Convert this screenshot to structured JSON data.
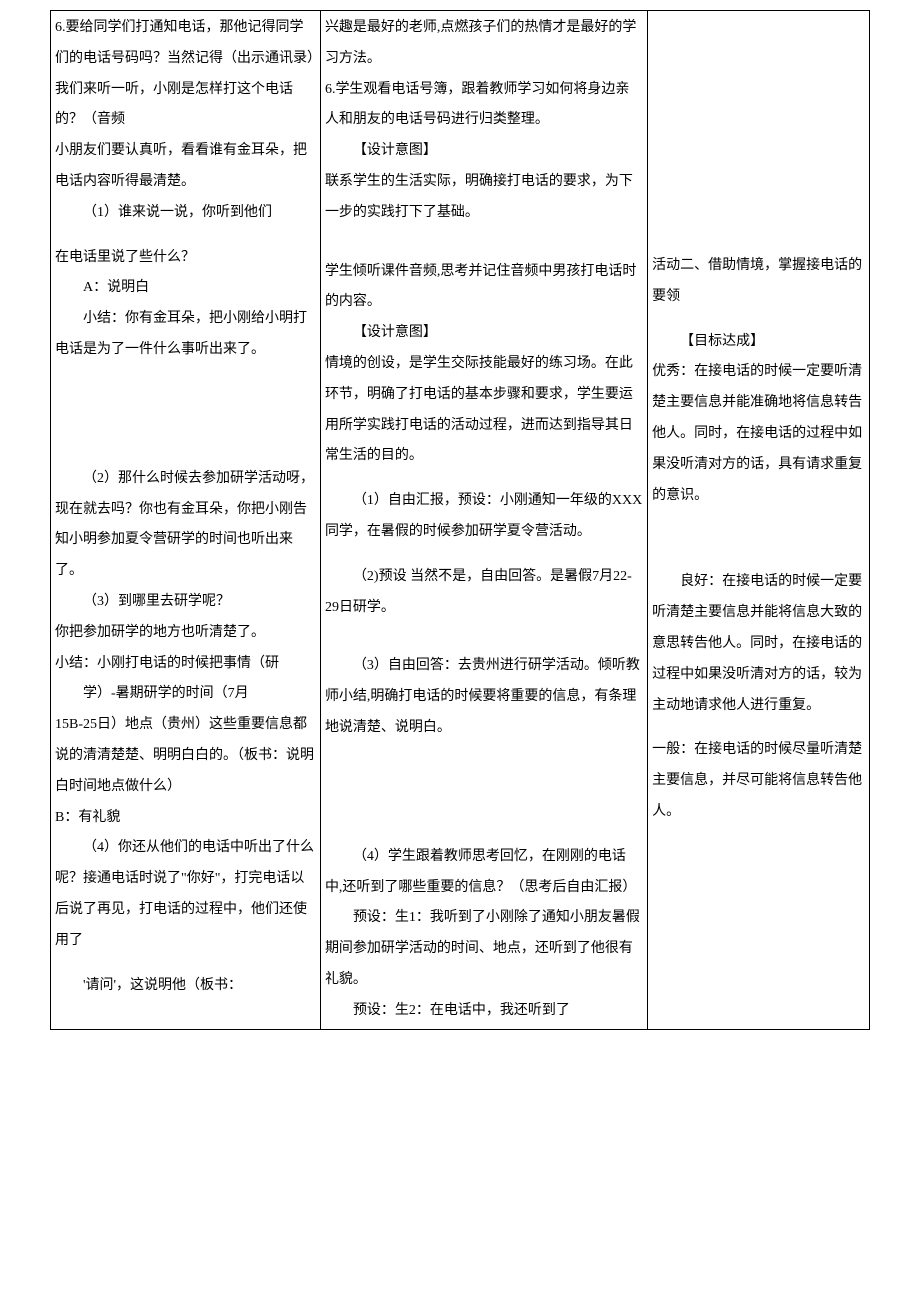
{
  "col1": {
    "p1": "6.要给同学们打通知电话，那他记得同学们的电话号码吗？当然记得（出示通讯录）我们来听一听，小刚是怎样打这个电话的？（音频",
    "p2": "小朋友们要认真听，看看谁有金耳朵，把电话内容听得最清楚。",
    "p3": "（1）谁来说一说，你听到他们",
    "p4": "在电话里说了些什么？",
    "p5": "A：说明白",
    "p6": "小结：你有金耳朵，把小刚给小明打电话是为了一件什么事听出来了。",
    "p7": "（2）那什么时候去参加研学活动呀，现在就去吗？你也有金耳朵，你把小刚告知小明参加夏令营研学的时间也听出来了。",
    "p8": "（3）到哪里去研学呢？",
    "p9": "你把参加研学的地方也听清楚了。",
    "p10": "小结：小刚打电话的时候把事情（研",
    "p11": "学）-暑期研学的时间（7月",
    "p12": "15B-25日）地点（贵州）这些重要信息都说的清清楚楚、明明白白的。（板书：说明白时间地点做什么）",
    "p13": "B：有礼貌",
    "p14": "（4）你还从他们的电话中听出了什么呢？接通电话时说了\"你好\"，打完电话以后说了再见，打电话的过程中，他们还使用了",
    "p15": "'请问'，这说明他（板书："
  },
  "col2": {
    "p1": "兴趣是最好的老师,点燃孩子们的热情才是最好的学习方法。",
    "p2": "6.学生观看电话号簿，跟着教师学习如何将身边亲人和朋友的电话号码进行归类整理。",
    "p3": "【设计意图】",
    "p4": "联系学生的生活实际，明确接打电话的要求，为下一步的实践打下了基础。",
    "p5": "学生倾听课件音频,思考并记住音频中男孩打电话时的内容。",
    "p6": "【设计意图】",
    "p7": "情境的创设，是学生交际技能最好的练习场。在此环节，明确了打电话的基本步骤和要求，学生要运用所学实践打电话的活动过程，进而达到指导其日常生活的目的。",
    "p8": "（1）自由汇报，预设：小刚通知一年级的XXX同学，在暑假的时候参加研学夏令营活动。",
    "p9": "（2)预设 当然不是，自由回答。是暑假7月22-29日研学。",
    "p10": "（3）自由回答：去贵州进行研学活动。倾听教师小结,明确打电话的时候要将重要的信息，有条理地说清楚、说明白。",
    "p11": "（4）学生跟着教师思考回忆，在刚刚的电话中,还听到了哪些重要的信息？（思考后自由汇报）",
    "p12": "预设：生1：我听到了小刚除了通知小朋友暑假期间参加研学活动的时间、地点，还听到了他很有礼貌。",
    "p13": "预设：生2：在电话中，我还听到了"
  },
  "col3": {
    "p1": "活动二、借助情境，掌握接电话的要领",
    "p2": "【目标达成】",
    "p3": "优秀：在接电话的时候一定要听清楚主要信息并能准确地将信息转告他人。同时，在接电话的过程中如果没听清对方的话，具有请求重复的意识。",
    "p4": "良好：在接电话的时候一定要听清楚主要信息并能将信息大致的意思转告他人。同时，在接电话的过程中如果没听清对方的话，较为主动地请求他人进行重复。",
    "p5": "一般：在接电话的时候尽量听清楚主要信息，并尽可能将信息转告他人。"
  }
}
